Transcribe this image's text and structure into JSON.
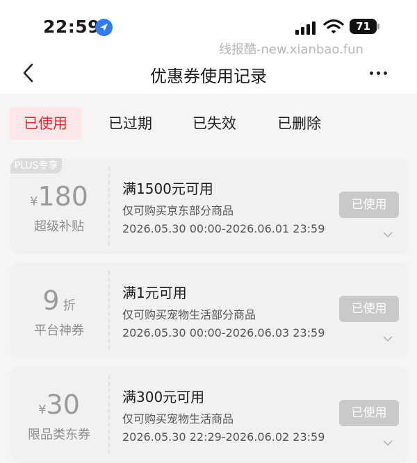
{
  "status_bar": {
    "time": "22:59",
    "battery": "71"
  },
  "watermark": "线报酷-new.xianbao.fun",
  "nav": {
    "title": "优惠券使用记录"
  },
  "tabs": [
    {
      "label": "已使用",
      "active": true
    },
    {
      "label": "已过期",
      "active": false
    },
    {
      "label": "已失效",
      "active": false
    },
    {
      "label": "已删除",
      "active": false
    }
  ],
  "coupons": [
    {
      "badge": "PLUS专享",
      "prefix": "¥",
      "amount": "180",
      "suffix": "",
      "label": "超级补贴",
      "condition": "满1500元可用",
      "scope": "仅可购买京东部分商品",
      "dates": "2026.05.30 00:00-2026.06.01 23:59",
      "button": "已使用"
    },
    {
      "badge": "",
      "prefix": "",
      "amount": "9",
      "suffix": "折",
      "label": "平台神券",
      "condition": "满1元可用",
      "scope": "仅可购买宠物生活部分商品",
      "dates": "2026.05.30 00:00-2026.06.03 23:59",
      "button": "已使用"
    },
    {
      "badge": "",
      "prefix": "¥",
      "amount": "30",
      "suffix": "",
      "label": "限品类东券",
      "condition": "满300元可用",
      "scope": "仅可购买宠物生活商品",
      "dates": "2026.05.30 22:29-2026.06.02 23:59",
      "button": "已使用"
    }
  ],
  "colors": {
    "accent": "#e5272e",
    "tab_active_bg": "#fde6e7",
    "button_disabled": "#c9c9c9",
    "location": "#2f7cf6"
  }
}
